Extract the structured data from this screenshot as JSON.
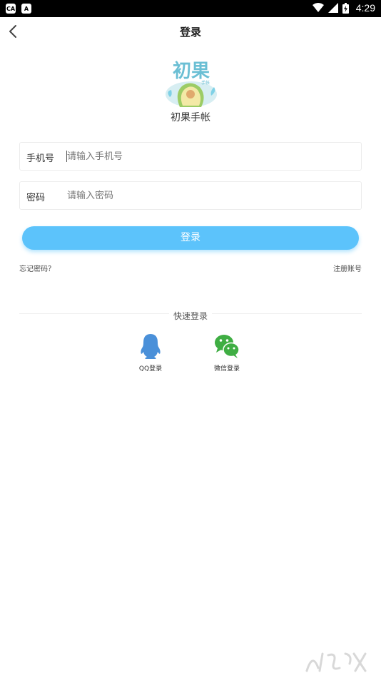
{
  "status_bar": {
    "time": "4:29",
    "left_icons": [
      "ca-notification-icon",
      "a-notification-icon"
    ],
    "right_icons": [
      "wifi-icon",
      "signal-icon",
      "battery-icon"
    ]
  },
  "nav": {
    "title": "登录",
    "back_icon": "chevron-left-icon"
  },
  "logo": {
    "text": "初果",
    "subtext": "手帐",
    "app_name": "初果手帐"
  },
  "form": {
    "phone": {
      "label": "手机号",
      "placeholder": "请输入手机号",
      "value": ""
    },
    "password": {
      "label": "密码",
      "placeholder": "请输入密码",
      "value": ""
    },
    "login_label": "登录",
    "forgot_label": "忘记密码？",
    "register_label": "注册账号"
  },
  "quick_login": {
    "title": "快速登录",
    "options": [
      {
        "label": "QQ登录",
        "icon": "qq-penguin-icon",
        "color": "#4a90d9"
      },
      {
        "label": "微信登录",
        "icon": "wechat-icon",
        "color": "#3fae43"
      }
    ]
  },
  "colors": {
    "accent": "#5cc3fb",
    "qq": "#4a90d9",
    "wechat": "#3fae43"
  }
}
